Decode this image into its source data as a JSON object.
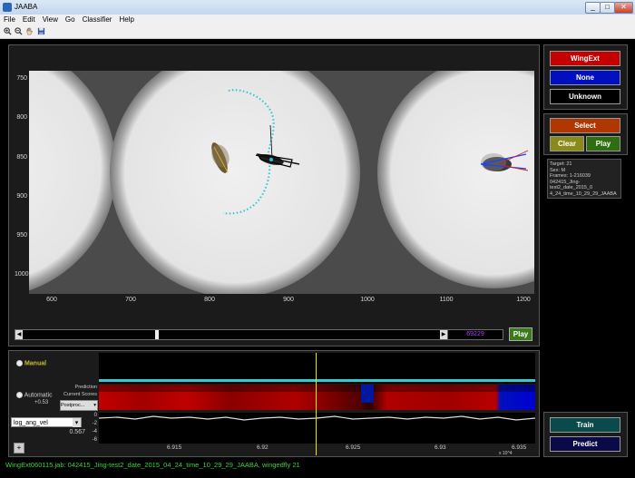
{
  "window": {
    "title": "JAABA",
    "controls": [
      "_",
      "□",
      "✕"
    ]
  },
  "menu": [
    "File",
    "Edit",
    "View",
    "Go",
    "Classifier",
    "Help"
  ],
  "toolbar": {
    "icons": [
      "zoom-in-icon",
      "zoom-out-icon",
      "pan-hand-icon",
      "save-icon"
    ]
  },
  "image_axes": {
    "y_ticks": [
      "750",
      "800",
      "850",
      "900",
      "950",
      "1000"
    ],
    "x_ticks": [
      "600",
      "700",
      "800",
      "900",
      "1000",
      "1100",
      "1200"
    ]
  },
  "navigation": {
    "frame_number": "69229",
    "play_label": "Play"
  },
  "labels_panel": {
    "behavior_button": "WingExt",
    "none_button": "None",
    "unknown_button": "Unknown",
    "select_button": "Select",
    "clear_button": "Clear",
    "play_button": "Play"
  },
  "target_info": {
    "target": "Target: 21",
    "sex": "Sex: M",
    "frames": "Frames: 1-216039",
    "experiment_line1": "042415_Jing-test2_date_2015_0",
    "experiment_line2": "4_24_time_10_29_29_JAABA"
  },
  "timeline": {
    "manual_label": "Manual",
    "automatic_label": "Automatic",
    "threshold": "+0.53",
    "prediction_label": "Prediction",
    "current_scores_label": "Current Scores",
    "postproc_select": "Postproc...",
    "feature_select": "log_ang_vel",
    "feature_value": "0.567",
    "add_button": "+",
    "y_ticks": [
      "0",
      "-2",
      "-4",
      "-6"
    ],
    "x_ticks": [
      "6.915",
      "6.92",
      "6.925",
      "6.93",
      "6.935"
    ],
    "x_scale": "x 10^4",
    "colors": {
      "behavior": "#b00000",
      "none": "#0010b0",
      "cursor": "#e8e020",
      "manual_line": "#39c8d0"
    }
  },
  "classifier": {
    "train_button": "Train",
    "predict_button": "Predict"
  },
  "status": "WingExt060115.jab: 042415_Jing-test2_date_2015_04_24_time_10_29_29_JAABA, wingedfly 21"
}
